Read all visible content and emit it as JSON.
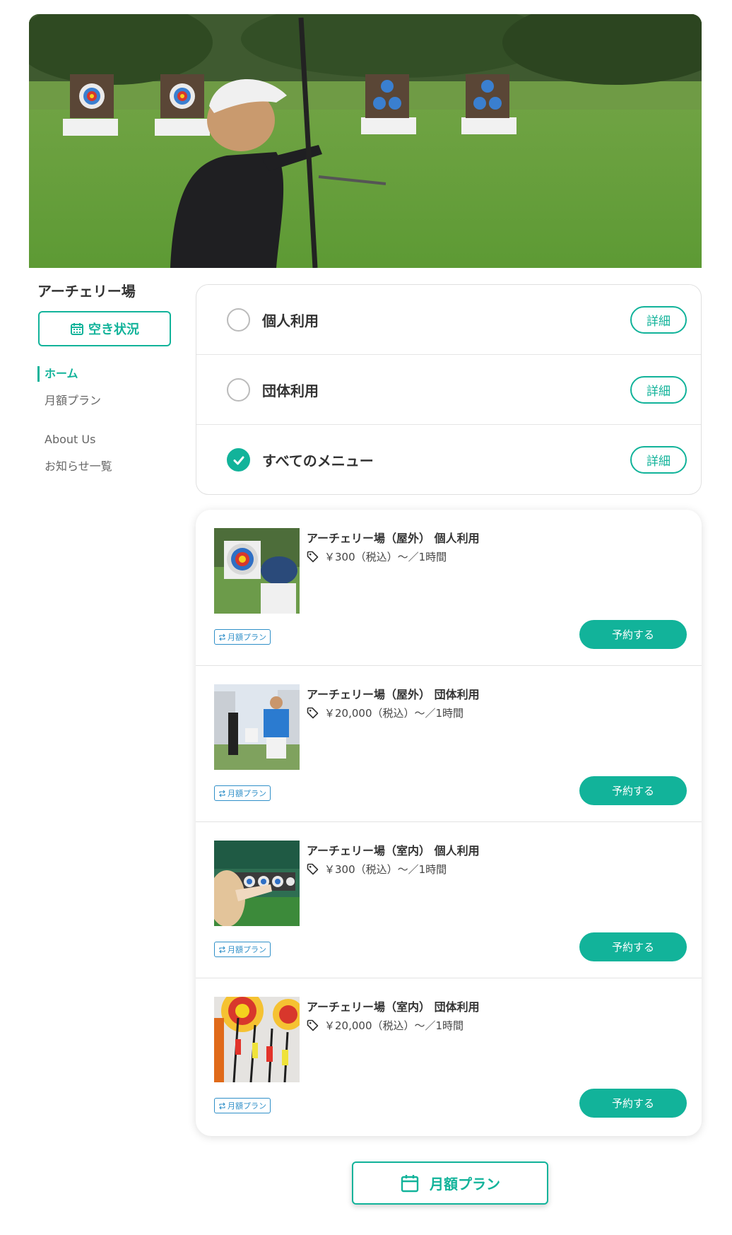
{
  "facility": {
    "name": "アーチェリー場"
  },
  "availability_button": {
    "label": "空き状況"
  },
  "nav": {
    "items": [
      {
        "label": "ホーム"
      },
      {
        "label": "月額プラン"
      },
      {
        "label": "About Us"
      },
      {
        "label": "お知らせ一覧"
      }
    ],
    "active": "ホーム"
  },
  "menu_filter": {
    "options": [
      {
        "label": "個人利用",
        "selected": false,
        "detail_label": "詳細"
      },
      {
        "label": "団体利用",
        "selected": false,
        "detail_label": "詳細"
      },
      {
        "label": "すべてのメニュー",
        "selected": true,
        "detail_label": "詳細"
      }
    ]
  },
  "plans": [
    {
      "title": "アーチェリー場（屋外） 個人利用",
      "price": "￥300（税込）〜／1時間",
      "badge": "月額プラン",
      "button": "予約する"
    },
    {
      "title": "アーチェリー場（屋外） 団体利用",
      "price": "￥20,000（税込）〜／1時間",
      "badge": "月額プラン",
      "button": "予約する"
    },
    {
      "title": "アーチェリー場（室内） 個人利用",
      "price": "￥300（税込）〜／1時間",
      "badge": "月額プラン",
      "button": "予約する"
    },
    {
      "title": "アーチェリー場（室内） 団体利用",
      "price": "￥20,000（税込）〜／1時間",
      "badge": "月額プラン",
      "button": "予約する"
    }
  ],
  "monthly_plan_button": {
    "label": "月額プラン"
  },
  "colors": {
    "accent": "#12b39a",
    "badge": "#2f8fc8"
  },
  "icons": {
    "availability": "calendar-icon",
    "price": "tag-icon",
    "badge": "repeat-icon",
    "monthly": "calendar-icon",
    "selected": "check-icon"
  }
}
